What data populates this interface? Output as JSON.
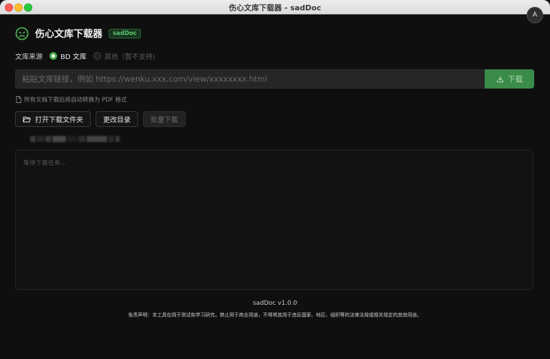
{
  "window": {
    "title": "伤心文库下载器 - sadDoc"
  },
  "translate_badge": "A",
  "header": {
    "app_name": "伤心文库下载器",
    "tag": "sadDoc"
  },
  "source": {
    "label": "文库来源",
    "options": [
      {
        "label": "BD 文库",
        "selected": true
      },
      {
        "label": "其他（暂不支持）",
        "selected": false
      }
    ]
  },
  "url_input": {
    "placeholder": "粘贴文库链接，例如 https://wenku.xxx.com/view/xxxxxxxx.html",
    "value": ""
  },
  "download_button": {
    "label": "下载"
  },
  "hint": "所有文档下载后将自动转换为 PDF 格式",
  "actions": {
    "open_folder": "打开下载文件夹",
    "change_dir": "更改目录",
    "batch_download": "批量下载"
  },
  "log": {
    "placeholder": "等待下载任务..."
  },
  "footer": {
    "version": "sadDoc v1.0.0",
    "disclaimer": "免责声明：本工具仅用于测试和学习研究，禁止用于商业用途，不得将其用于违反国家、地区、组织等的法律法规或相关规定的其他用途。"
  },
  "icons": {
    "logo": "sad-face-icon",
    "download": "download-icon",
    "document": "document-icon",
    "folder": "folder-open-icon"
  },
  "colors": {
    "accent": "#4caf50",
    "download_button_bg": "#3b8b49",
    "background": "#0f0f0f"
  }
}
